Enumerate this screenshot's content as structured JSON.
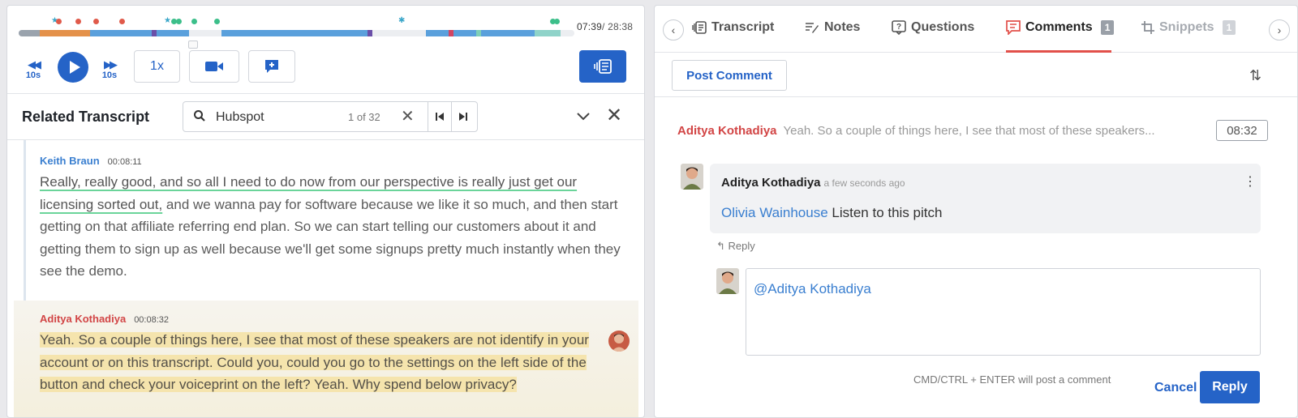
{
  "player": {
    "current_time": "07:39",
    "total_time": "/ 28:38",
    "progress": 0.267,
    "rewind_label": "10s",
    "forward_label": "10s",
    "speed_label": "1x"
  },
  "related_transcript": {
    "title": "Related Transcript",
    "search_value": "Hubspot",
    "search_count": "1 of 32",
    "entries": [
      {
        "speaker": "Keith Braun",
        "timestamp": "00:08:11",
        "highlighted_text": "Really, really good, and so all I need to do now from our perspective is really just get our licensing sorted out,",
        "text": " and we wanna pay for software because we like it so much, and then start getting on that affiliate referring end plan. So we can start telling our customers about it and getting them to sign up as well because we'll get some signups pretty much instantly when they see the demo."
      },
      {
        "speaker": "Aditya Kothadiya",
        "timestamp": "00:08:32",
        "text": "Yeah. So a couple of things here, I see that most of these speakers are not identify in your account or on this transcript. Could you, could you go to the settings on the left side of the button and check your voiceprint on the left? Yeah. Why spend below privacy?"
      }
    ]
  },
  "tabs": [
    {
      "label": "Transcript"
    },
    {
      "label": "Notes"
    },
    {
      "label": "Questions"
    },
    {
      "label": "Comments",
      "badge": "1"
    },
    {
      "label": "Snippets",
      "badge": "1"
    }
  ],
  "comments": {
    "post_label": "Post Comment",
    "quote_author": "Aditya Kothadiya",
    "quote_text": "Yeah. So a couple of things here, I see that most of these speakers...",
    "quote_time": "08:32",
    "card_author": "Aditya Kothadiya",
    "card_time_ago": "a few seconds ago",
    "mention": "Olivia Wainhouse",
    "body": " Listen to this pitch",
    "reply_link": "Reply",
    "reply_draft": "@Aditya Kothadiya",
    "hint": "CMD/CTRL + ENTER will post a comment",
    "cancel_label": "Cancel",
    "reply_label": "Reply"
  },
  "colors": {
    "accent": "#2563c7",
    "active_tab": "#e2504a",
    "speaker_blue": "#3a7fd0",
    "speaker_red": "#d24545",
    "highlight": "#f5e4ad"
  }
}
